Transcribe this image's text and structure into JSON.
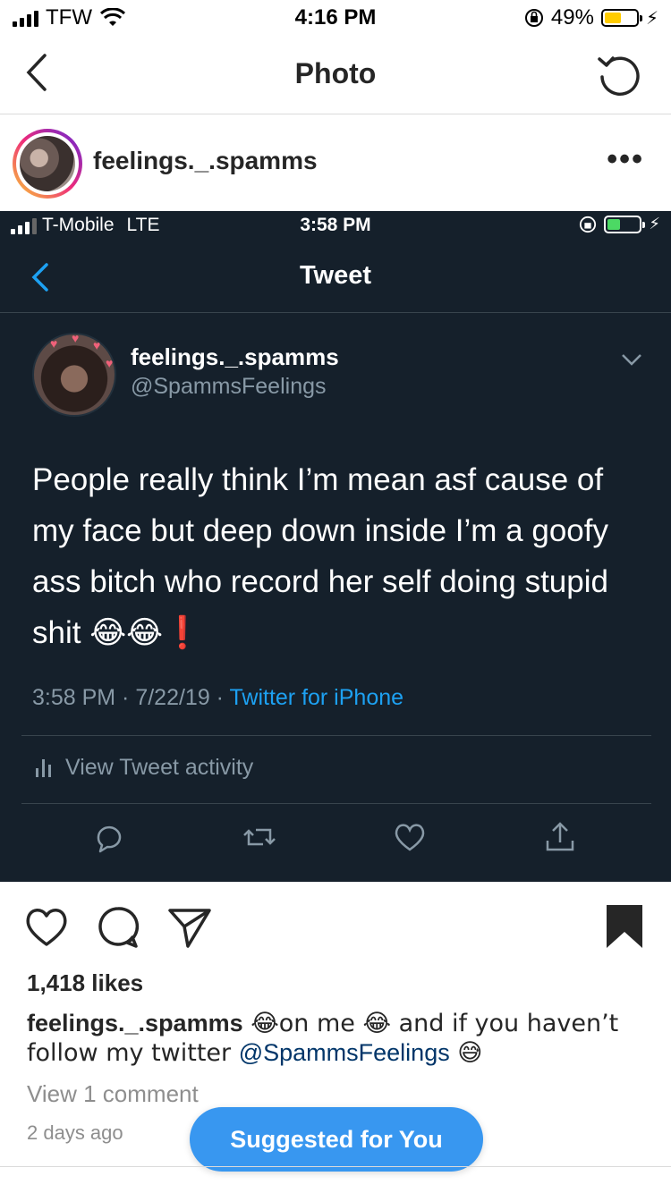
{
  "statusbar": {
    "carrier": "TFW",
    "time": "4:16 PM",
    "battery_pct": "49%",
    "battery_level": 0.49,
    "battery_color": "#ffcc00"
  },
  "nav": {
    "title": "Photo"
  },
  "post": {
    "username": "feelings._.spamms",
    "more": "•••"
  },
  "tweet_screenshot": {
    "status": {
      "carrier": "T-Mobile",
      "network": "LTE",
      "time": "3:58 PM",
      "battery_color": "#4cd964"
    },
    "nav_title": "Tweet",
    "author_name": "feelings._.spamms",
    "author_handle": "@SpammsFeelings",
    "text": "People really think I’m mean asf cause of my face but deep down inside I’m a goofy ass bitch who record her self doing stupid shit 😂😂❗",
    "meta_time": "3:58 PM · 7/22/19 · ",
    "meta_source": "Twitter for iPhone",
    "activity_label": "View Tweet activity"
  },
  "ig": {
    "likes": "1,418 likes",
    "caption_user": "feelings._.spamms",
    "caption_part1": " 😂on me 😂 and if you haven’t follow my twitter ",
    "caption_mention": "@SpammsFeelings",
    "caption_part2": " 😅",
    "view_comments": "View 1 comment",
    "time_ago": "2 days ago",
    "suggested": "Suggested for You"
  }
}
